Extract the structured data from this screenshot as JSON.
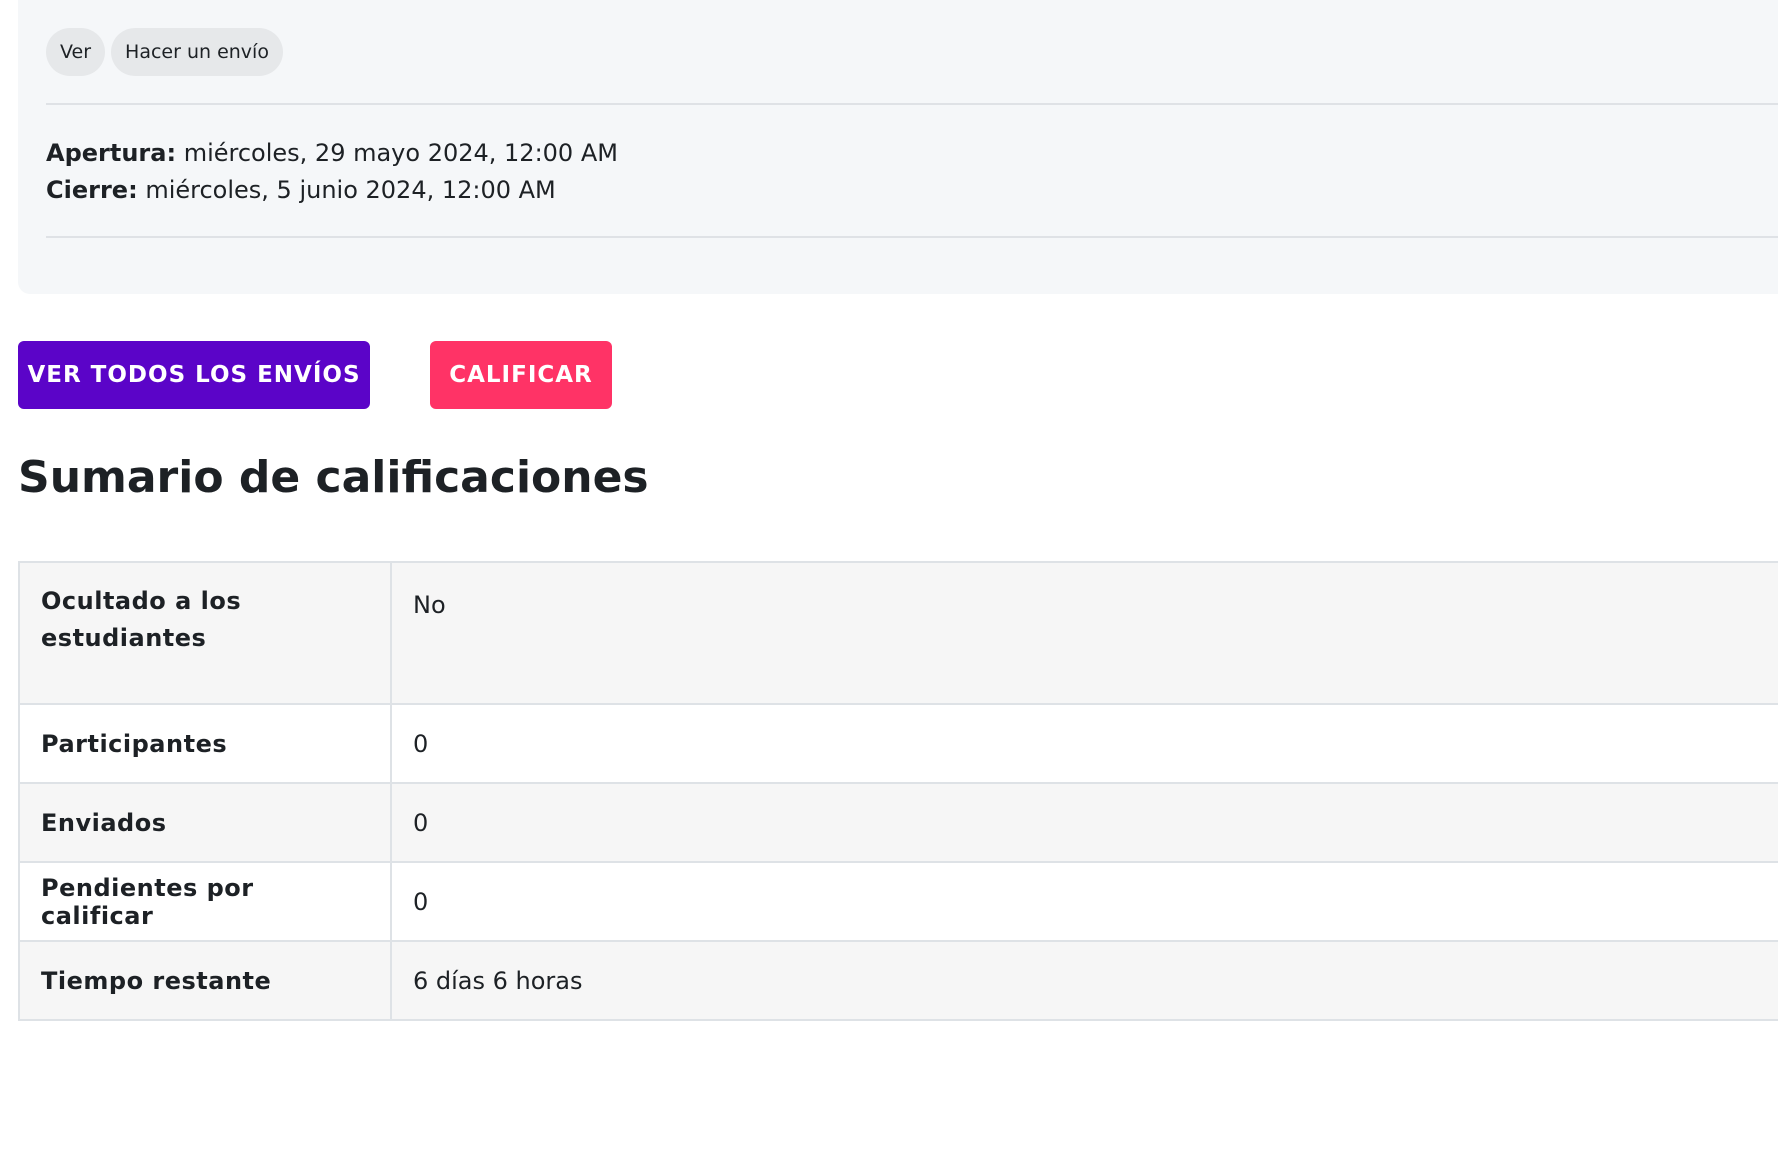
{
  "activity": {
    "tags": [
      "Ver",
      "Hacer un envío"
    ],
    "opening_label": "Apertura:",
    "opening_value": "miércoles, 29 mayo 2024, 12:00 AM",
    "closing_label": "Cierre:",
    "closing_value": "miércoles, 5 junio 2024, 12:00 AM"
  },
  "actions": {
    "view_all_label": "VER TODOS LOS ENVÍOS",
    "grade_label": "CALIFICAR"
  },
  "summary": {
    "title": "Sumario de calificaciones",
    "rows": [
      {
        "label": "Ocultado a los estudiantes",
        "value": "No"
      },
      {
        "label": "Participantes",
        "value": "0"
      },
      {
        "label": "Enviados",
        "value": "0"
      },
      {
        "label": "Pendientes por calificar",
        "value": "0"
      },
      {
        "label": "Tiempo restante",
        "value": "6 días 6 horas"
      }
    ]
  },
  "colors": {
    "primary_button": "#5b04c8",
    "danger_button": "#ff3366",
    "card_background": "#f5f7f9"
  }
}
